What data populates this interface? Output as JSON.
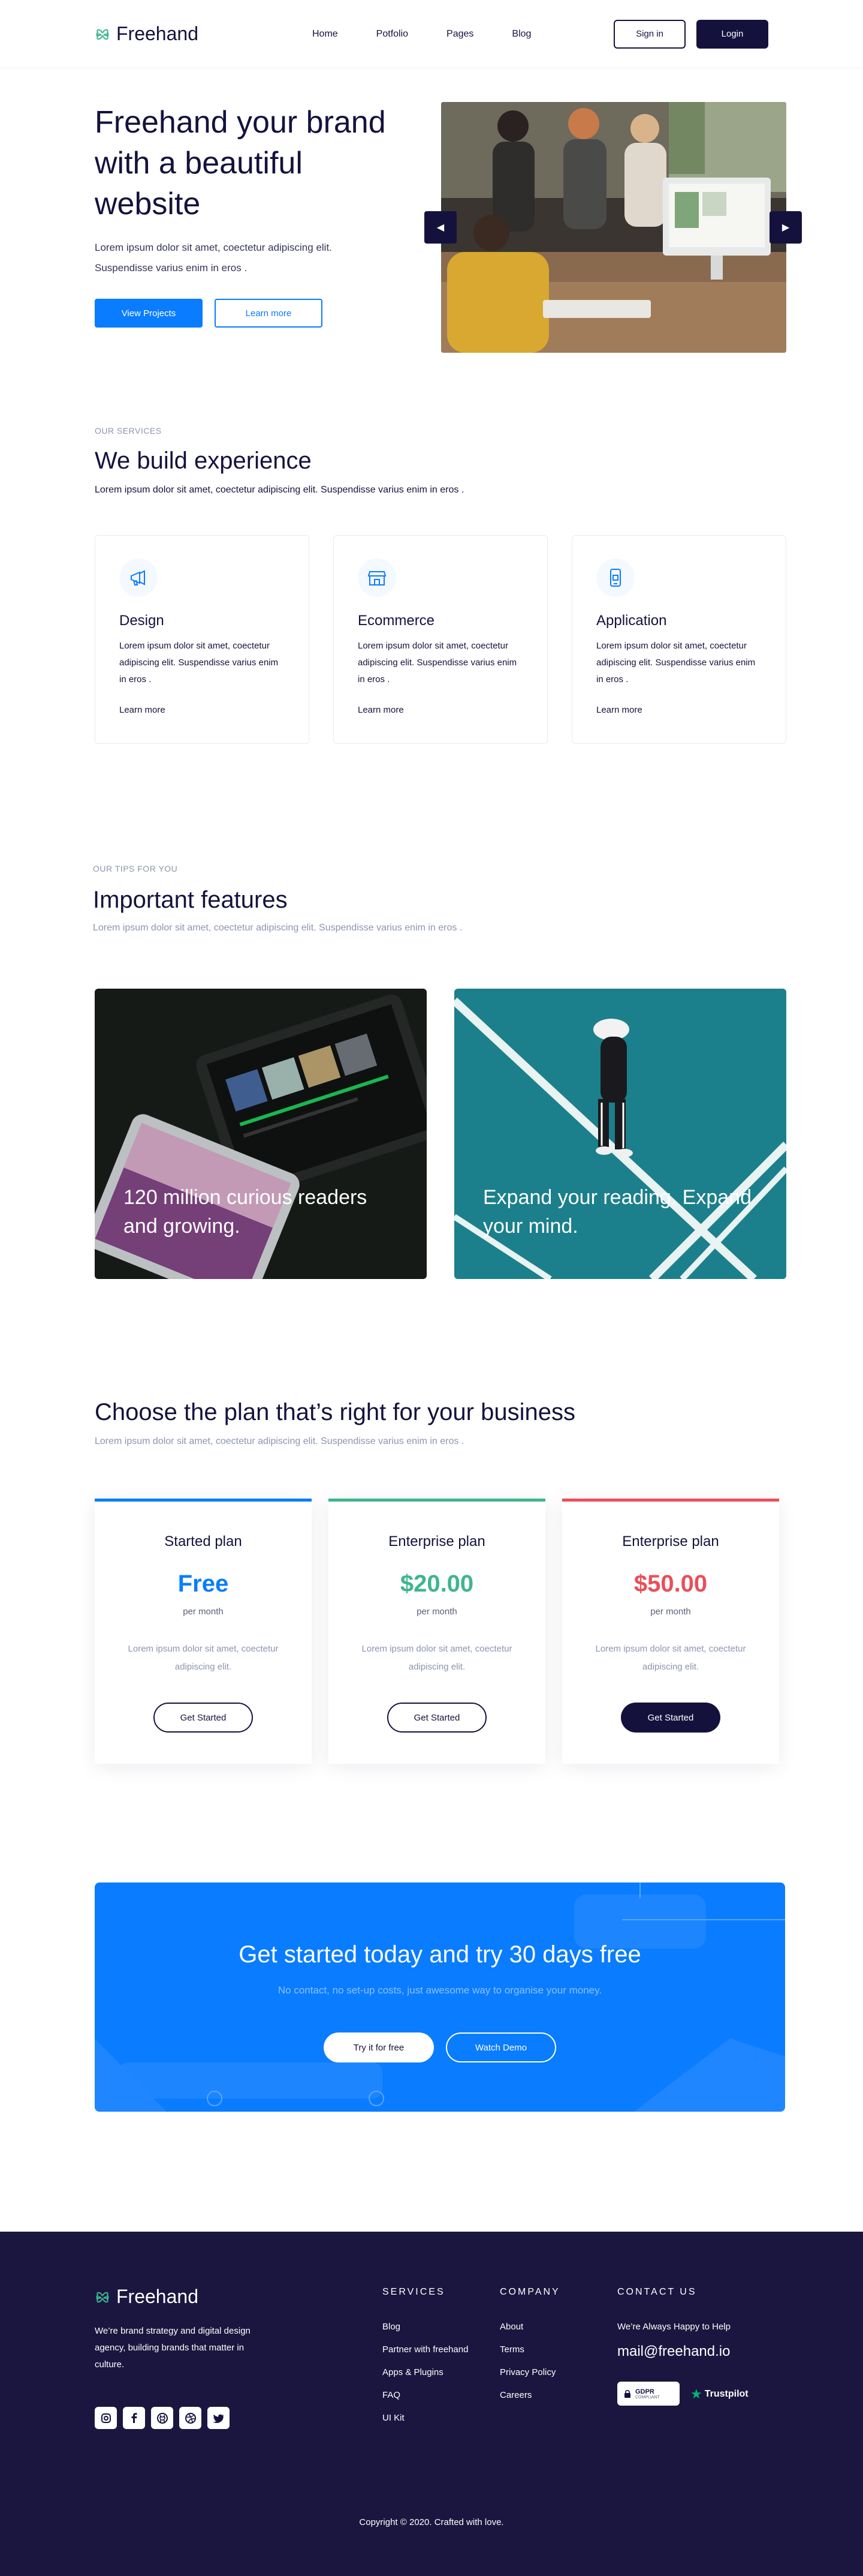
{
  "header": {
    "brand": "Freehand",
    "nav": [
      "Home",
      "Potfolio",
      "Pages",
      "Blog"
    ],
    "signin_label": "Sign in",
    "login_label": "Login"
  },
  "hero": {
    "title": "Freehand your brand with a beautiful website",
    "subtitle": "Lorem ipsum dolor sit amet, coectetur adipiscing elit. Suspendisse varius enim in eros .",
    "primary_label": "View Projects",
    "secondary_label": "Learn more",
    "image_icon": "office-team-photo",
    "prev_icon": "triangle-left-icon",
    "next_icon": "triangle-right-icon"
  },
  "services": {
    "eyebrow": "OUR SERVICES",
    "title": "We build experience",
    "subtitle": "Lorem ipsum dolor sit amet, coectetur adipiscing elit. Suspendisse varius enim in eros .",
    "cards": [
      {
        "icon": "megaphone-icon",
        "title": "Design",
        "text": "Lorem ipsum dolor sit amet, coectetur adipiscing elit. Suspendisse varius enim in eros .",
        "link": "Learn more"
      },
      {
        "icon": "store-icon",
        "title": "Ecommerce",
        "text": "Lorem ipsum dolor sit amet, coectetur adipiscing elit. Suspendisse varius enim in eros .",
        "link": "Learn more"
      },
      {
        "icon": "mobile-app-icon",
        "title": "Application",
        "text": "Lorem ipsum dolor sit amet, coectetur adipiscing elit. Suspendisse varius enim in eros .",
        "link": "Learn more"
      }
    ]
  },
  "features": {
    "eyebrow": "OUR TIPS FOR YOU",
    "title": "Important features",
    "subtitle": "Lorem ipsum dolor sit amet, coectetur adipiscing elit. Suspendisse varius enim in eros .",
    "items": [
      {
        "text": "120 million curious readers and growing."
      },
      {
        "text": "Expand your reading. Expand your mind."
      }
    ]
  },
  "pricing": {
    "title": "Choose the plan that’s right for your business",
    "subtitle": "Lorem ipsum dolor sit amet, coectetur adipiscing elit. Suspendisse varius enim in eros .",
    "plans": [
      {
        "name": "Started plan",
        "price": "Free",
        "per": "per month",
        "desc": "Lorem ipsum dolor sit amet, coectetur adipiscing elit.",
        "button": "Get Started",
        "color": "#0a7cff"
      },
      {
        "name": "Enterprise plan",
        "price": "$20.00",
        "per": "per month",
        "desc": "Lorem ipsum dolor sit amet, coectetur adipiscing elit.",
        "button": "Get Started",
        "color": "#3fb58f"
      },
      {
        "name": "Enterprise plan",
        "price": "$50.00",
        "per": "per month",
        "desc": "Lorem ipsum dolor sit amet, coectetur adipiscing elit.",
        "button": "Get Started",
        "color": "#ea4f5a"
      }
    ]
  },
  "cta": {
    "title": "Get started today and try 30 days free",
    "subtitle": "No contact, no set-up costs, just awesome way to organise your money.",
    "primary_label": "Try it for free",
    "secondary_label": "Watch Demo"
  },
  "footer": {
    "brand": "Freehand",
    "about": "We’re brand strategy and digital design agency, building brands that matter in culture.",
    "socials": [
      "instagram-icon",
      "facebook-icon",
      "github-icon",
      "dribbble-icon",
      "twitter-icon"
    ],
    "services_title": "SERVICES",
    "services": [
      "Blog",
      "Partner with freehand",
      "Apps & Plugins",
      "FAQ",
      "UI Kit"
    ],
    "company_title": "COMPANY",
    "company": [
      "About",
      "Terms",
      "Privacy Policy",
      "Careers"
    ],
    "contact_title": "CONTACT US",
    "contact_note": "We’re Always Happy to Help",
    "email": "mail@freehand.io",
    "gdpr_label": "GDPR",
    "gdpr_sub": "COMPLIANT",
    "trustpilot_label": "Trustpilot",
    "copyright": "Copyright © 2020. Crafted with love."
  },
  "colors": {
    "brand_dark": "#14123d",
    "brand_blue": "#0a7cff",
    "footer_bg": "#1a163f",
    "accent_green": "#3fb58f",
    "accent_red": "#ea4f5a"
  }
}
